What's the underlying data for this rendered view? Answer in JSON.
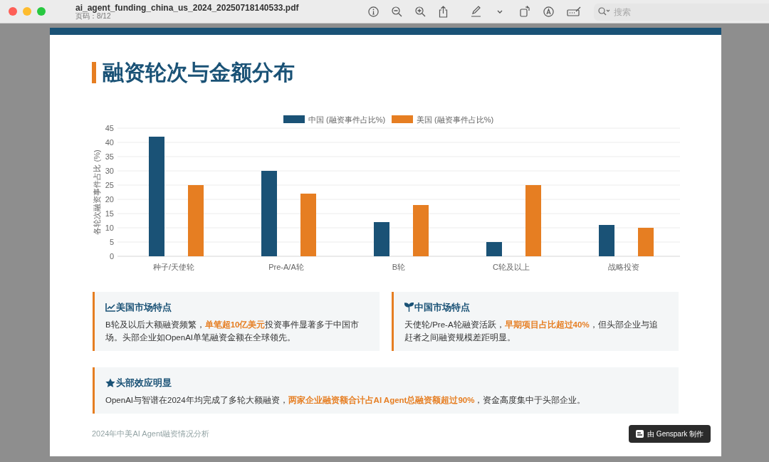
{
  "window": {
    "title": "ai_agent_funding_china_us_2024_20250718140533.pdf",
    "subtitle": "页码：8/12",
    "search": {
      "placeholder": "搜索"
    }
  },
  "slide": {
    "title": "融资轮次与金额分布",
    "chart": {
      "chart_data": {
        "type": "bar",
        "grid": true,
        "legend": true,
        "ylabel": "各轮次融资事件占比 (%)",
        "categories": [
          "种子/天使轮",
          "Pre-A/A轮",
          "B轮",
          "C轮及以上",
          "战略投资"
        ],
        "ylim": [
          0,
          45
        ],
        "yticks": [
          0,
          5,
          10,
          15,
          20,
          25,
          30,
          35,
          40,
          45
        ],
        "series": [
          {
            "name": "中国 (融资事件占比%)",
            "color": "#1a5276",
            "values": [
              42,
              30,
              12,
              5,
              11
            ]
          },
          {
            "name": "美国 (融资事件占比%)",
            "color": "#e67e22",
            "values": [
              25,
              22,
              18,
              25,
              10
            ]
          }
        ]
      }
    },
    "cards": [
      {
        "kind": "chart",
        "title": "美国市场特点",
        "text": "B轮及以后大额融资频繁，**单笔超10亿美元**投资事件显著多于中国市场。头部企业如OpenAI单笔融资金额在全球领先。"
      },
      {
        "kind": "sprout",
        "title": "中国市场特点",
        "text": "天使轮/Pre-A轮融资活跃，**早期项目占比超过40%**，但头部企业与追赶者之间融资规模差距明显。"
      },
      {
        "kind": "star",
        "title": "头部效应明显",
        "text": "OpenAI与智谱在2024年均完成了多轮大额融资，**两家企业融资额合计占AI Agent总融资额超过90%**，资金高度集中于头部企业。"
      }
    ],
    "footer": "2024年中美AI Agent融资情况分析",
    "badge": "由 Genspark 制作"
  }
}
